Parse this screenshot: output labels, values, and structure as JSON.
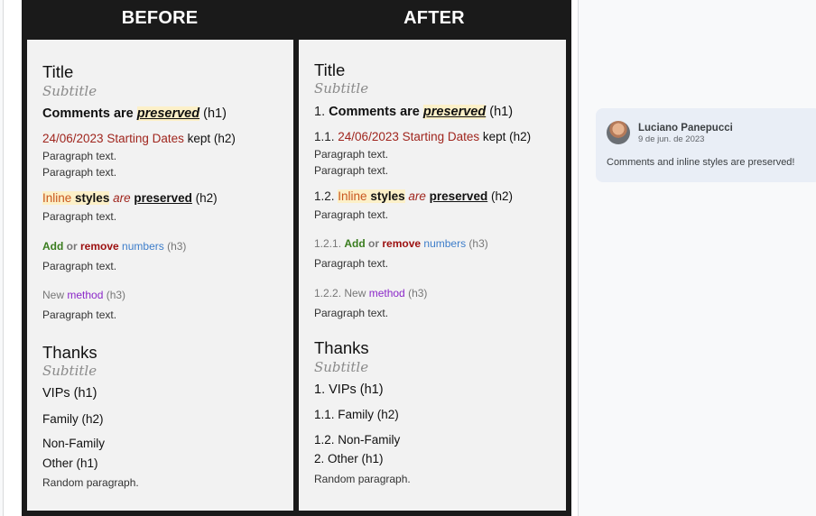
{
  "headers": {
    "before": "BEFORE",
    "after": "AFTER"
  },
  "before": {
    "title": "Title",
    "subtitle": "Subtitle",
    "s1": {
      "pre": "Comments are ",
      "preserved": "preserved",
      "tag": " (h1)"
    },
    "s2": {
      "date": "24/06/2023 Starting Dates",
      "rest": " kept (h2)"
    },
    "p1": "Paragraph text.",
    "p2": "Paragraph text.",
    "s3": {
      "inline": "Inline",
      "styles": "styles",
      "are": "are",
      "preserved": "preserved",
      "tag": " (h2)"
    },
    "p3": "Paragraph text.",
    "s4": {
      "add": "Add",
      "or": " or ",
      "remove": "remove",
      "numbers": "numbers",
      "tag": " (h3)"
    },
    "p4": "Paragraph text.",
    "s5": {
      "new": "New ",
      "method": "method",
      "tag": " (h3)"
    },
    "p5": "Paragraph text.",
    "thanks": "Thanks",
    "subtitle2": "Subtitle",
    "vips": "VIPs (h1)",
    "family": "Family (h2)",
    "nonfamily": "Non-Family",
    "other": "Other (h1)",
    "random": "Random paragraph."
  },
  "after": {
    "title": "Title",
    "subtitle": "Subtitle",
    "s1": {
      "num": "1. ",
      "pre": "Comments are ",
      "preserved": "preserved",
      "tag": " (h1)"
    },
    "s2": {
      "num": "1.1. ",
      "date": "24/06/2023 Starting Dates",
      "rest": " kept (h2)"
    },
    "p1": "Paragraph text.",
    "p2": "Paragraph text.",
    "s3": {
      "num": "1.2. ",
      "inline": "Inline",
      "styles": "styles",
      "are": "are",
      "preserved": "preserved",
      "tag": " (h2)"
    },
    "p3": "Paragraph text.",
    "s4": {
      "num": "1.2.1. ",
      "add": "Add",
      "or": " or ",
      "remove": "remove",
      "numbers": "numbers",
      "tag": " (h3)"
    },
    "p4": "Paragraph text.",
    "s5": {
      "num": "1.2.2. ",
      "new": "New ",
      "method": "method",
      "tag": " (h3)"
    },
    "p5": "Paragraph text.",
    "thanks": "Thanks",
    "subtitle2": "Subtitle",
    "vips": "1. VIPs (h1)",
    "family": "1.1. Family (h2)",
    "nonfamily": "1.2. Non-Family",
    "other": "2. Other (h1)",
    "random": "Random paragraph."
  },
  "comment": {
    "author": "Luciano Panepucci",
    "date": "9 de jun. de 2023",
    "text": "Comments and inline styles are preserved!"
  }
}
